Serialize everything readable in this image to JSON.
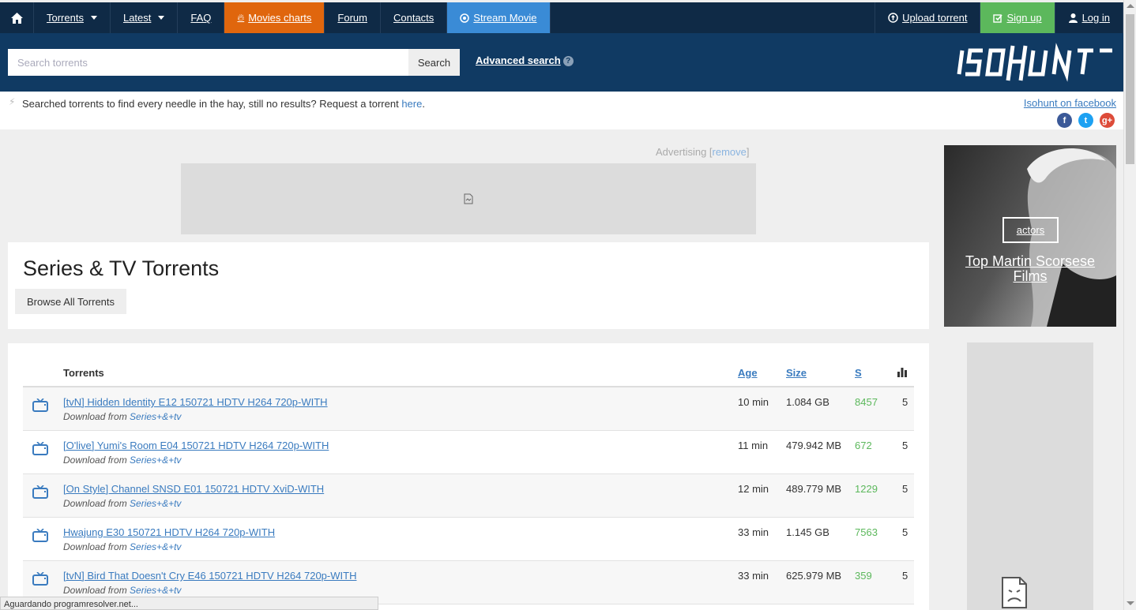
{
  "nav": {
    "torrents": "Torrents",
    "latest": "Latest",
    "faq": "FAQ",
    "movies_charts": "Movies charts",
    "forum": "Forum",
    "contacts": "Contacts",
    "stream_movie": "Stream Movie",
    "upload": "Upload torrent",
    "signup": "Sign up",
    "login": "Log in"
  },
  "search": {
    "placeholder": "Search torrents",
    "button": "Search",
    "advanced": "Advanced search"
  },
  "notice": {
    "text": "Searched torrents to find every needle in the hay, still no results? Request a torrent ",
    "link": "here",
    "end": ".",
    "facebook": "Isohunt on facebook"
  },
  "ad": {
    "label": "Advertising [",
    "remove": "remove",
    "close": "]"
  },
  "page": {
    "title": "Series & TV Torrents",
    "browse_button": "Browse All Torrents"
  },
  "table": {
    "headers": {
      "name": "Torrents",
      "age": "Age",
      "size": "Size",
      "seeds": "S"
    },
    "rows": [
      {
        "name": "[tvN] Hidden Identity E12 150721 HDTV H264 720p-WITH",
        "from": "Download from ",
        "source": "Series+&+tv",
        "age": "10 min",
        "size": "1.084 GB",
        "seeds": "8457",
        "rating": "5"
      },
      {
        "name": "[O'live] Yumi's Room E04 150721 HDTV H264 720p-WITH",
        "from": "Download from ",
        "source": "Series+&+tv",
        "age": "11 min",
        "size": "479.942 MB",
        "seeds": "672",
        "rating": "5"
      },
      {
        "name": "[On Style] Channel SNSD E01 150721 HDTV XviD-WITH",
        "from": "Download from ",
        "source": "Series+&+tv",
        "age": "12 min",
        "size": "489.779 MB",
        "seeds": "1229",
        "rating": "5"
      },
      {
        "name": "Hwajung E30 150721 HDTV H264 720p-WITH",
        "from": "Download from ",
        "source": "Series+&+tv",
        "age": "33 min",
        "size": "1.145 GB",
        "seeds": "7563",
        "rating": "5"
      },
      {
        "name": "[tvN] Bird That Doesn't Cry E46 150721 HDTV H264 720p-WITH",
        "from": "Download from ",
        "source": "Series+&+tv",
        "age": "33 min",
        "size": "625.979 MB",
        "seeds": "359",
        "rating": "5"
      }
    ]
  },
  "promo": {
    "tag": "actors",
    "title": "Top Martin Scorsese Films"
  },
  "status": "Aguardando programresolver.net...",
  "colors": {
    "nav_bg": "#0f2a46",
    "header_bg": "#103a63",
    "orange": "#e0660d",
    "blue": "#3a8bd6",
    "green": "#5cb85c",
    "link": "#3a7bbf"
  },
  "icons": [
    "home-icon",
    "fire-icon",
    "play-circle-icon",
    "upload-icon",
    "edit-icon",
    "user-icon",
    "help-icon",
    "bolt-icon",
    "facebook-icon",
    "twitter-icon",
    "google-plus-icon",
    "tv-icon",
    "bar-chart-icon",
    "broken-image-icon"
  ]
}
